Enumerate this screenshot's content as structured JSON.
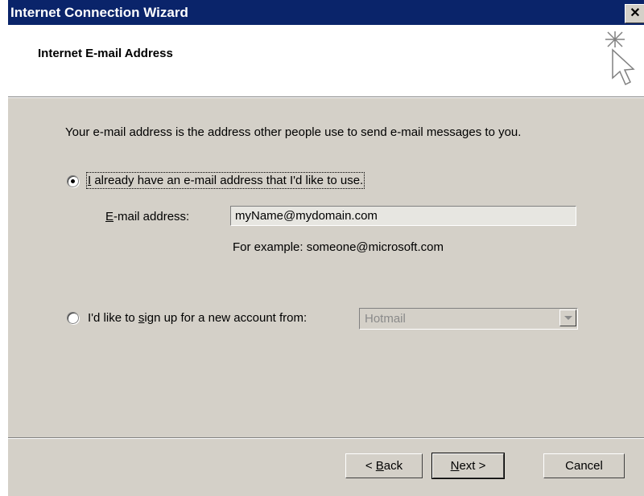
{
  "window": {
    "title": "Internet Connection Wizard",
    "close_label": "✕"
  },
  "header": {
    "title": "Internet E-mail Address",
    "icon": "wizard-sparkle-cursor-icon"
  },
  "body": {
    "description": "Your e-mail address is the address other people use to send e-mail messages to you.",
    "option_existing": {
      "label_mnemonic": "I",
      "label_rest": " already have an e-mail address that I'd like to use.",
      "selected": true
    },
    "email": {
      "label_mnemonic": "E",
      "label_rest": "-mail address:",
      "value": "myName@mydomain.com",
      "example": "For example: someone@microsoft.com"
    },
    "option_new": {
      "label_pre": "I'd like to ",
      "label_mnemonic": "s",
      "label_rest": "ign up for a new account from:",
      "selected": false,
      "provider": "Hotmail"
    }
  },
  "footer": {
    "back_pre": "< ",
    "back_mnemonic": "B",
    "back_rest": "ack",
    "next_mnemonic": "N",
    "next_rest": "ext >",
    "cancel": "Cancel"
  }
}
